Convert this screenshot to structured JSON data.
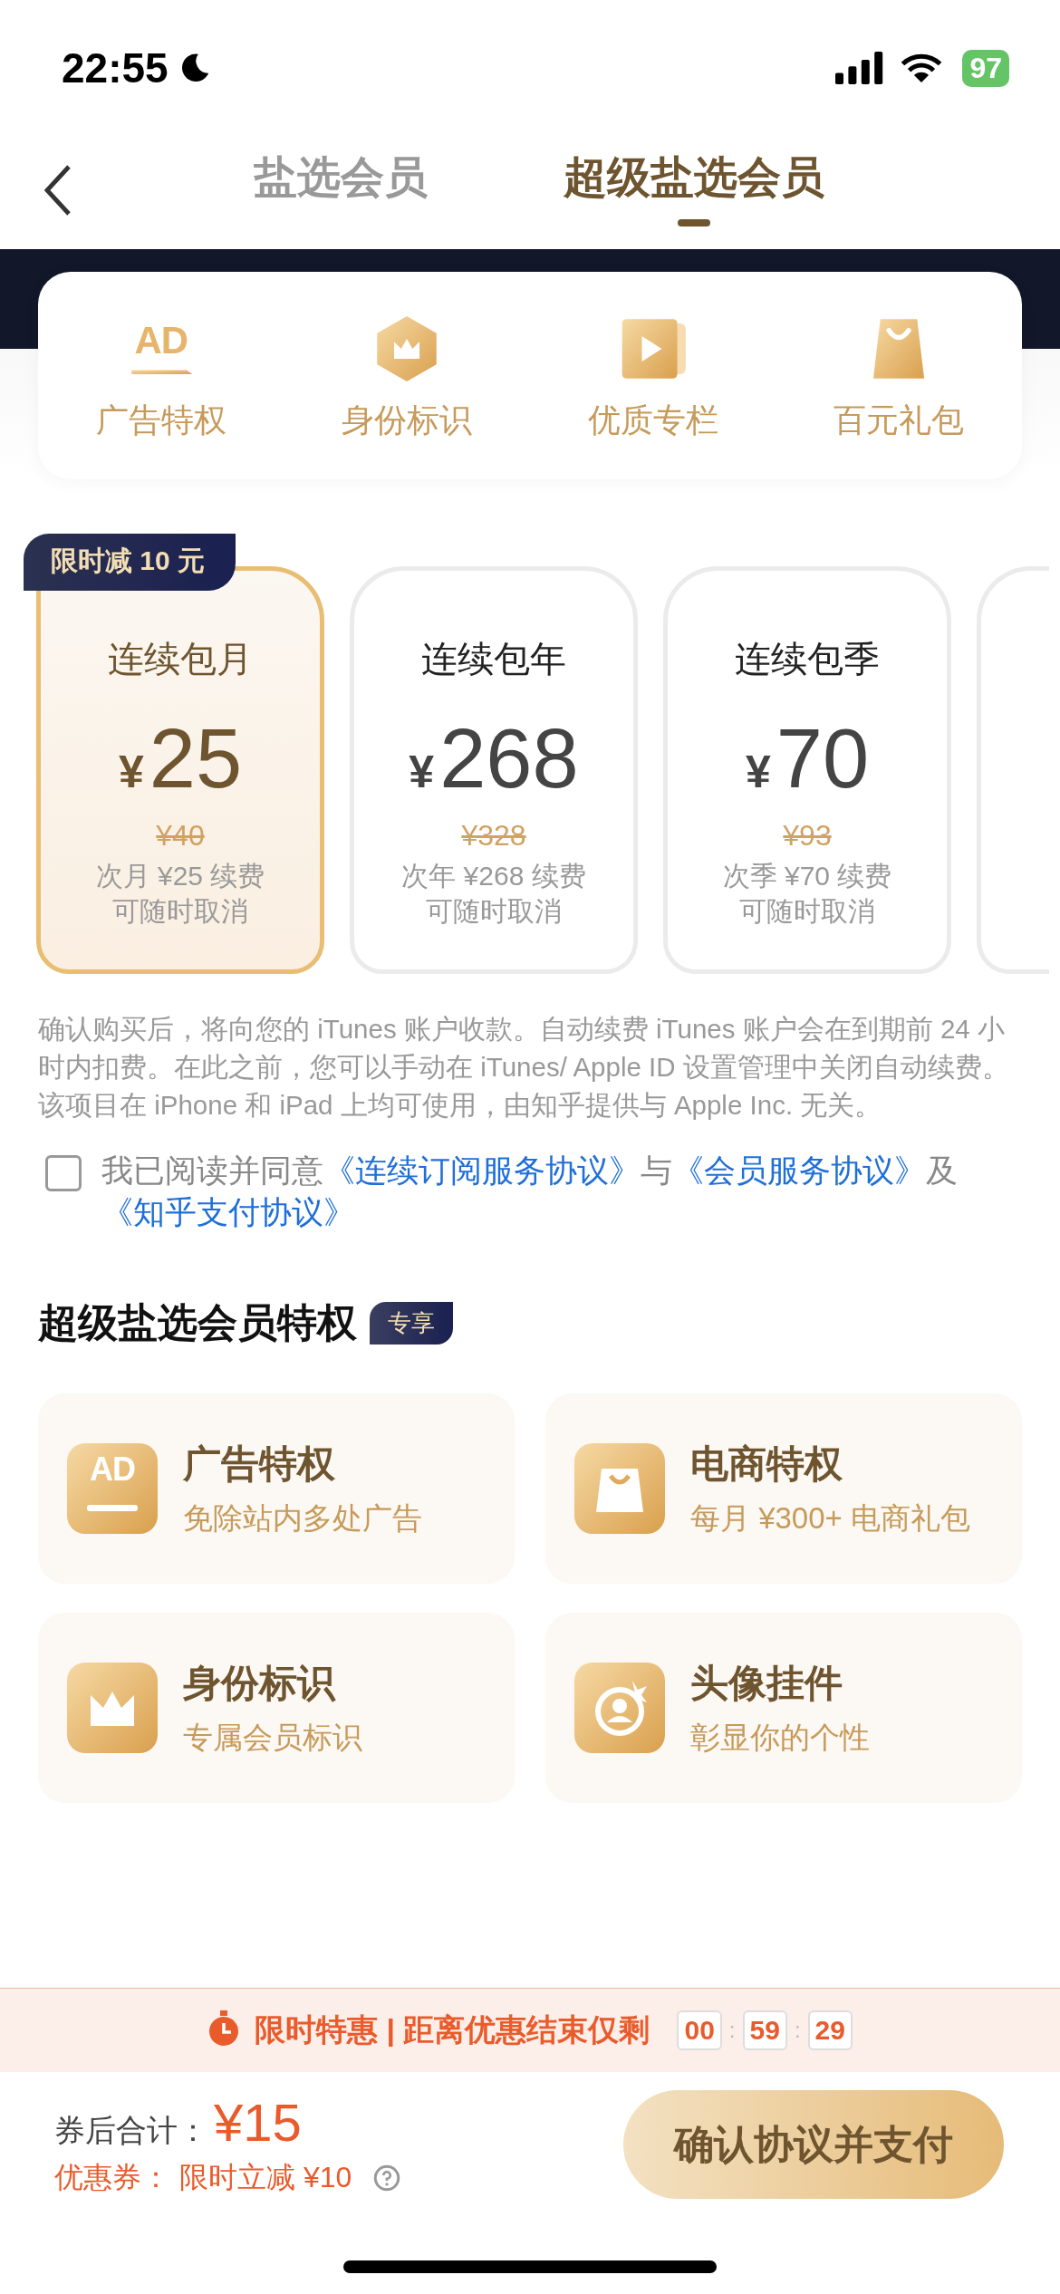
{
  "status_bar": {
    "time": "22:55",
    "battery": "97"
  },
  "tabs": [
    {
      "label": "盐选会员",
      "selected": false
    },
    {
      "label": "超级盐选会员",
      "selected": true
    }
  ],
  "benefits": [
    {
      "label": "广告特权",
      "kind": "ad",
      "icon_text": "AD"
    },
    {
      "label": "身份标识",
      "kind": "crown"
    },
    {
      "label": "优质专栏",
      "kind": "video"
    },
    {
      "label": "百元礼包",
      "kind": "bag"
    }
  ],
  "plans": [
    {
      "badge": "限时减 10 元",
      "name": "连续包月",
      "currency": "¥",
      "amount": "25",
      "original": "¥40",
      "renew": "次月 ¥25 续费",
      "cancel": "可随时取消",
      "selected": true
    },
    {
      "name": "连续包年",
      "currency": "¥",
      "amount": "268",
      "original": "¥328",
      "renew": "次年 ¥268 续费",
      "cancel": "可随时取消",
      "selected": false
    },
    {
      "name": "连续包季",
      "currency": "¥",
      "amount": "70",
      "original": "¥93",
      "renew": "次季 ¥70 续费",
      "cancel": "可随时取消",
      "selected": false
    }
  ],
  "disclaimer": [
    "确认购买后，将向您的 iTunes 账户收款。自动续费 iTunes 账户会在到期前 24 小时内扣费。在此之前，您可以手动在 iTunes/ Apple ID 设置管理中关闭自动续费。",
    "该项目在 iPhone 和 iPad 上均可使用，由知乎提供与 Apple Inc. 无关。"
  ],
  "agreement": {
    "checked": false,
    "parts": [
      {
        "kind": "text",
        "text": "我已阅读并同意"
      },
      {
        "kind": "link",
        "text": "《连续订阅服务协议》"
      },
      {
        "kind": "text",
        "text": "与"
      },
      {
        "kind": "link",
        "text": "《会员服务协议》"
      },
      {
        "kind": "text",
        "text": "及"
      },
      {
        "kind": "link",
        "text": "《知乎支付协议》"
      }
    ]
  },
  "perks_section": {
    "title": "超级盐选会员特权",
    "tag": "专享"
  },
  "perks": [
    {
      "title": "广告特权",
      "subtitle": "免除站内多处广告",
      "kind": "ad",
      "icon_text": "AD"
    },
    {
      "title": "电商特权",
      "subtitle": "每月 ¥300+ 电商礼包",
      "kind": "bag"
    },
    {
      "title": "身份标识",
      "subtitle": "专属会员标识",
      "kind": "crown"
    },
    {
      "title": "头像挂件",
      "subtitle": "彰显你的个性",
      "kind": "avatar"
    }
  ],
  "promo_banner": {
    "text": "限时特惠 | 距离优惠结束仅剩",
    "countdown": [
      "00",
      "59",
      "29"
    ],
    "separator": ":"
  },
  "footer": {
    "total_label": "券后合计：",
    "total": "¥15",
    "coupon_label": "优惠券：",
    "coupon": "限时立减 ¥10",
    "pay_button": "确认协议并支付"
  }
}
